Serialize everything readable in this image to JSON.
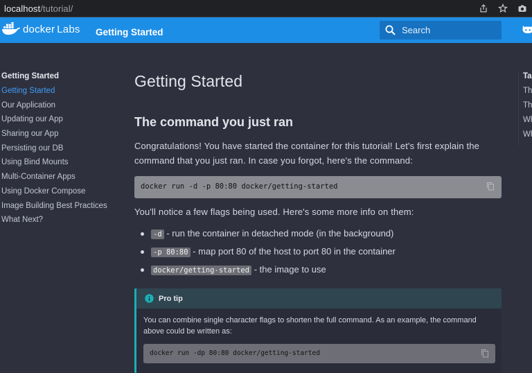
{
  "browser": {
    "url_host": "localhost",
    "url_path": "/tutorial/",
    "icons": [
      "share-icon",
      "star-icon",
      "camera-icon"
    ]
  },
  "header": {
    "brand_docker": "docker",
    "brand_labs": "Labs",
    "title": "Getting Started",
    "search_placeholder": "Search",
    "accent_color": "#1d8ee6"
  },
  "sidebar": {
    "heading": "Getting Started",
    "items": [
      {
        "label": "Getting Started",
        "active": true
      },
      {
        "label": "Our Application",
        "active": false
      },
      {
        "label": "Updating our App",
        "active": false
      },
      {
        "label": "Sharing our App",
        "active": false
      },
      {
        "label": "Persisting our DB",
        "active": false
      },
      {
        "label": "Using Bind Mounts",
        "active": false
      },
      {
        "label": "Multi-Container Apps",
        "active": false
      },
      {
        "label": "Using Docker Compose",
        "active": false
      },
      {
        "label": "Image Building Best Practices",
        "active": false
      },
      {
        "label": "What Next?",
        "active": false
      }
    ]
  },
  "toc": {
    "title": "Ta",
    "items": [
      "Th",
      "Th",
      "Wh",
      "Wh"
    ]
  },
  "main": {
    "page_title": "Getting Started",
    "section_title": "The command you just ran",
    "intro_line1": "Congratulations! You have started the container for this tutorial! Let's first explain the",
    "intro_line2": "command that you just ran. In case you forgot, here's the command:",
    "command": "docker run -d -p 80:80 docker/getting-started",
    "flags_intro": "You'll notice a few flags being used. Here's some more info on them:",
    "bullets": [
      {
        "code": "-d",
        "text": " - run the container in detached mode (in the background)"
      },
      {
        "code": "-p 80:80",
        "text": " - map port 80 of the host to port 80 in the container"
      },
      {
        "code": "docker/getting-started",
        "text": " - the image to use"
      }
    ],
    "tip": {
      "title": "Pro tip",
      "body_line1": "You can combine single character flags to shorten the full command. As an example, the command",
      "body_line2": "above could be written as:",
      "command": "docker run -dp 80:80 docker/getting-started"
    }
  }
}
